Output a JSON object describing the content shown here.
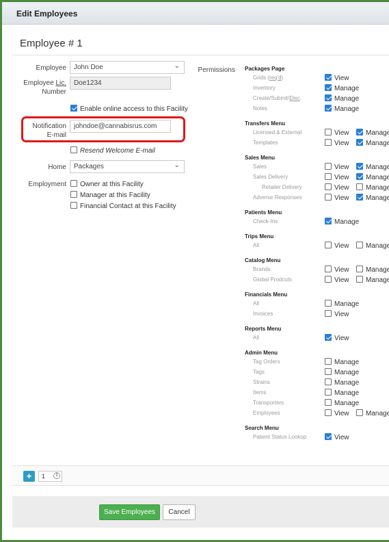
{
  "window": {
    "title": "Edit Employees"
  },
  "employee": {
    "heading": "Employee # 1",
    "employee_label": "Employee",
    "employee_value": "John Doe",
    "lic_label_1": "Employee ",
    "lic_label_link": "Lic.",
    "lic_label_2": "Number",
    "lic_value": "Doe1234",
    "online_access_label": "Enable online access to this Facility",
    "online_access_checked": true,
    "notif_label_1": "Notification",
    "notif_label_2": "E-mail",
    "notif_value": "johndoe@cannabisrus.com",
    "resend_label": "Resend Welcome E-mail",
    "home_label": "Home",
    "home_value": "Packages",
    "employment_label": "Employment",
    "employment_options": [
      {
        "label": "Owner at this Facility",
        "checked": false
      },
      {
        "label": "Manager at this Facility",
        "checked": false
      },
      {
        "label": "Financial Contact at this Facility",
        "checked": false
      }
    ]
  },
  "permissions": {
    "label": "Permissions",
    "view": "View",
    "manage": "Manage",
    "sections": [
      {
        "header": "Packages Page",
        "rows": [
          {
            "name_pre": "Grids (",
            "name_link": "req'd",
            "name_post": ")",
            "view": true
          },
          {
            "name": "Inventory",
            "manage": true
          },
          {
            "name_pre": "Create/Submit/",
            "name_link": "Disc",
            "name_post": ".",
            "manage": true
          },
          {
            "name": "Notes",
            "manage": true
          }
        ]
      },
      {
        "header": "Transfers Menu",
        "rows": [
          {
            "name": "Licensed & External",
            "view": false,
            "manage": true
          },
          {
            "name": "Templates",
            "view": false,
            "manage": true
          }
        ]
      },
      {
        "header": "Sales Menu",
        "rows": [
          {
            "name": "Sales",
            "view": false,
            "manage": true
          },
          {
            "name": "Sales Delivery",
            "view": false,
            "manage": true
          },
          {
            "name": "Retailer Delivery",
            "view": false,
            "manage": false
          },
          {
            "name": "Adverse Responses",
            "view": false,
            "manage": true
          }
        ]
      },
      {
        "header": "Patients Menu",
        "rows": [
          {
            "name": "Check-Ins",
            "manage": true
          }
        ]
      },
      {
        "header": "Trips Menu",
        "rows": [
          {
            "name": "All",
            "view": false,
            "manage": false
          }
        ]
      },
      {
        "header": "Catalog Menu",
        "rows": [
          {
            "name": "Brands",
            "view": false,
            "manage": false
          },
          {
            "name": "Global Prodcuts",
            "view": false,
            "manage": false
          }
        ]
      },
      {
        "header": "Financials Menu",
        "rows": [
          {
            "name": "All",
            "manage": false
          },
          {
            "name": "Invoices",
            "view": false
          }
        ]
      },
      {
        "header": "Reports Menu",
        "rows": [
          {
            "name": "All",
            "view": true
          }
        ]
      },
      {
        "header": "Admin Menu",
        "rows": [
          {
            "name": "Tag Orders",
            "manage": false
          },
          {
            "name": "Tags",
            "manage": false
          },
          {
            "name": "Strains",
            "manage": false
          },
          {
            "name": "Items",
            "manage": false
          },
          {
            "name": "Transporters",
            "manage": false
          },
          {
            "name": "Employees",
            "view": false,
            "manage": false
          }
        ]
      },
      {
        "header": "Search Menu",
        "rows": [
          {
            "name": "Patient Status Lookup",
            "view": true
          }
        ]
      }
    ]
  },
  "footer": {
    "add_label": "+",
    "qty_value": "1",
    "save_label": "Save Employees",
    "cancel_label": "Cancel"
  },
  "colors": {
    "frame": "#4d8a3f",
    "checkbox_on": "#2a7fd4",
    "highlight": "#e01818",
    "save": "#4caf50",
    "add": "#2f9cc4"
  }
}
